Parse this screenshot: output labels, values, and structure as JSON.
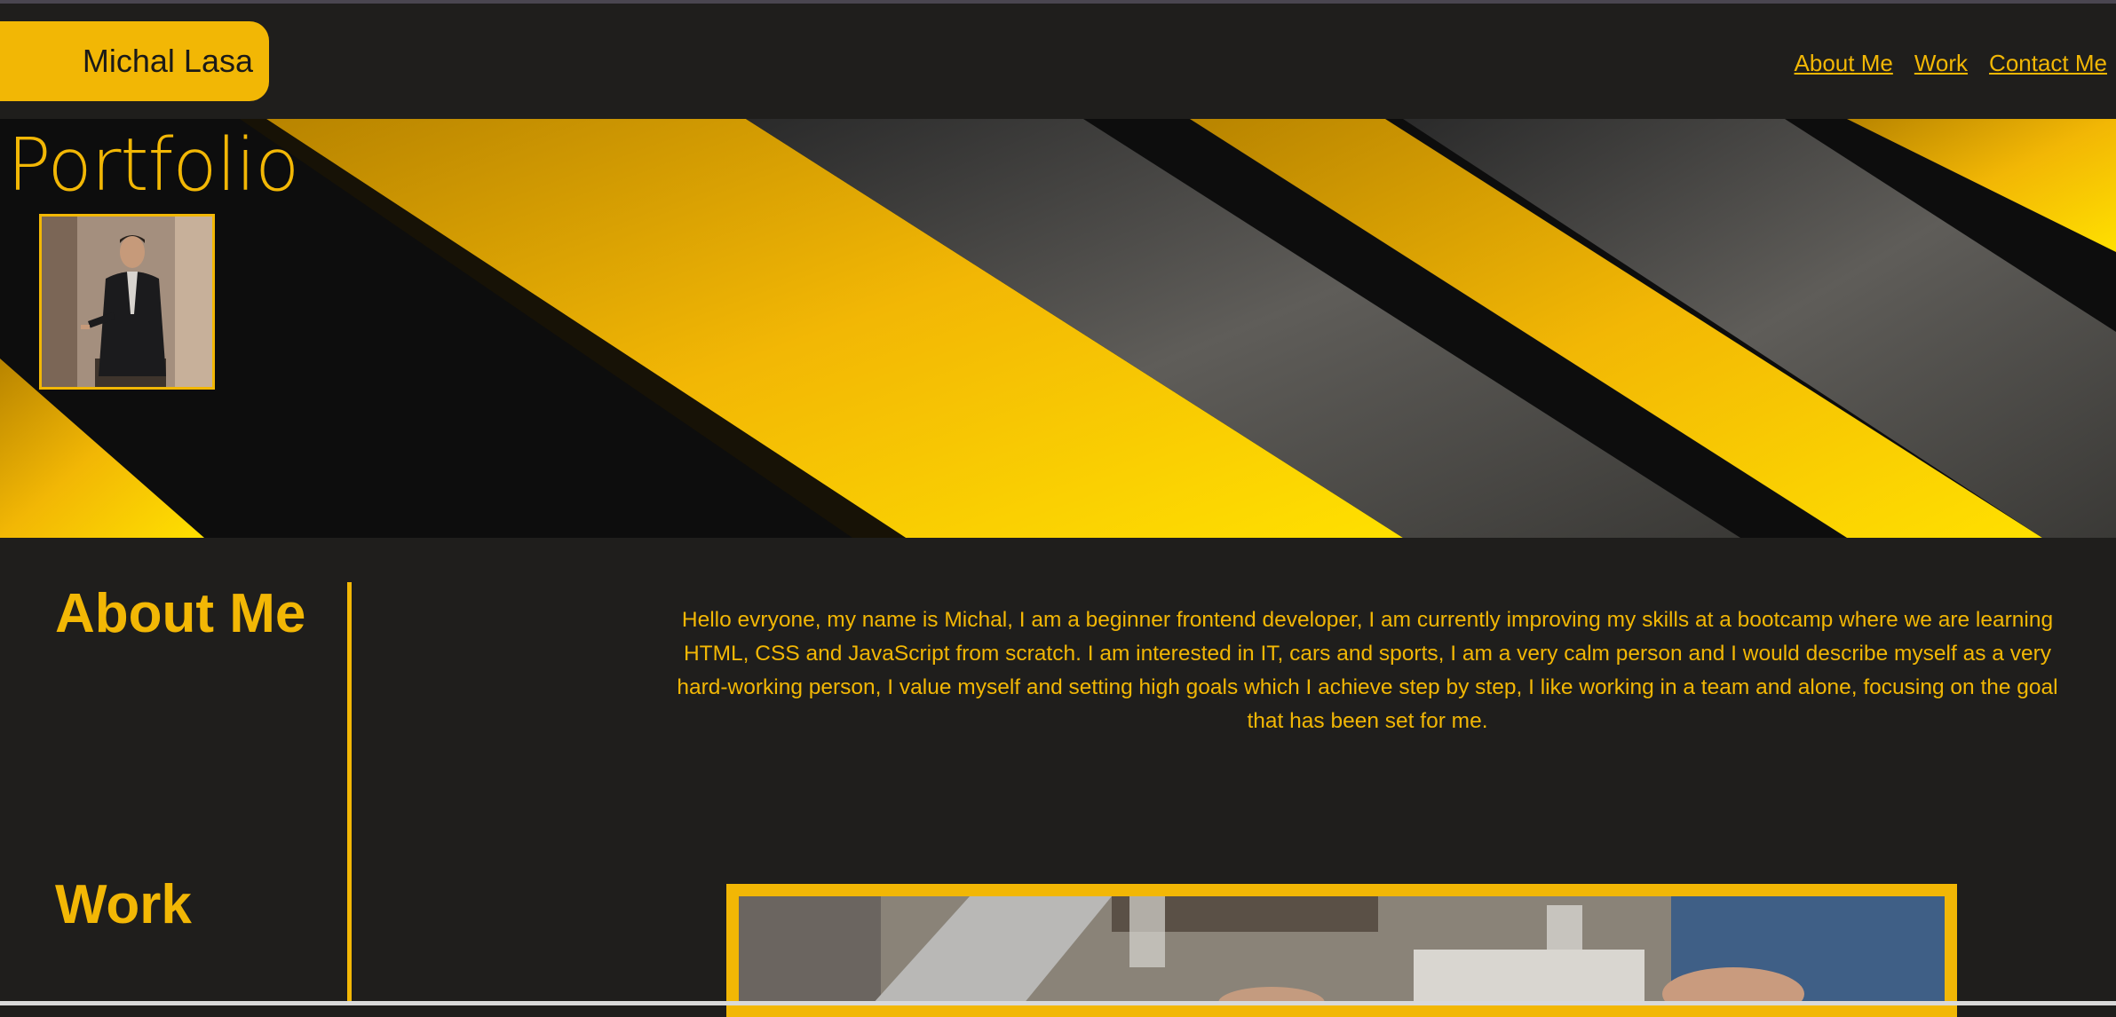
{
  "header": {
    "brand": "Michal Lasa",
    "nav": [
      "About Me",
      "Work",
      "Contact Me"
    ]
  },
  "hero": {
    "title": "Portfolio",
    "avatar_icon": "person-photo"
  },
  "sections": {
    "about_heading": "About Me",
    "work_heading": "Work",
    "about_text": "Hello evryone, my name is Michal, I am a beginner frontend developer, I am currently improving my skills at a bootcamp where we are learning HTML, CSS and JavaScript from scratch. I am interested in IT, cars and sports, I am a very calm person and I would describe myself as a very hard-working person, I value myself and setting high goals which I achieve step by step, I like working in a team and alone, focusing on the goal that has been set for me."
  },
  "colors": {
    "accent": "#f2b705",
    "background": "#1f1e1c",
    "brand_text": "#1b1a18"
  }
}
